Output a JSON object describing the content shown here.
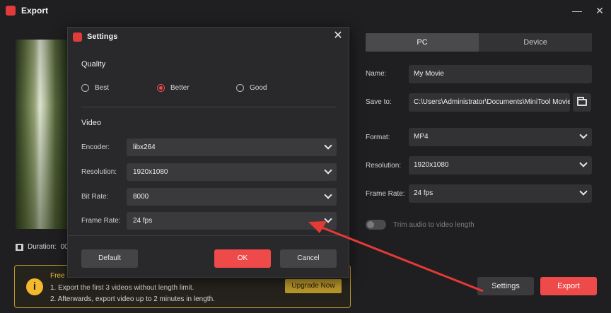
{
  "window": {
    "title": "Export",
    "minimize": "—",
    "close": "✕"
  },
  "preview": {
    "duration_label": "Duration:",
    "duration_value": "00"
  },
  "banner": {
    "title": "Free L",
    "line1": "1. Export the first 3 videos without length limit.",
    "line2": "2. Afterwards, export video up to 2 minutes in length.",
    "upgrade_label": "Upgrade Now",
    "info_glyph": "i"
  },
  "tabs": {
    "pc": "PC",
    "device": "Device"
  },
  "form": {
    "name_label": "Name:",
    "name_value": "My Movie",
    "save_label": "Save to:",
    "save_value": "C:\\Users\\Administrator\\Documents\\MiniTool Movie",
    "format_label": "Format:",
    "format_value": "MP4",
    "resolution_label": "Resolution:",
    "resolution_value": "1920x1080",
    "framerate_label": "Frame Rate:",
    "framerate_value": "24 fps"
  },
  "trim": {
    "label": "Trim audio to video length",
    "enabled": false
  },
  "buttons": {
    "settings": "Settings",
    "export": "Export"
  },
  "dialog": {
    "title": "Settings",
    "close": "✕",
    "quality_title": "Quality",
    "quality_options": [
      "Best",
      "Better",
      "Good"
    ],
    "quality_selected": "Better",
    "video_title": "Video",
    "encoder_label": "Encoder:",
    "encoder_value": "libx264",
    "resolution_label": "Resolution:",
    "resolution_value": "1920x1080",
    "bitrate_label": "Bit Rate:",
    "bitrate_value": "8000",
    "framerate_label": "Frame Rate:",
    "framerate_value": "24 fps",
    "default_label": "Default",
    "ok_label": "OK",
    "cancel_label": "Cancel"
  },
  "colors": {
    "accent": "#ef4a4a",
    "banner": "#b9972b",
    "annotation_arrow": "#e53935"
  }
}
